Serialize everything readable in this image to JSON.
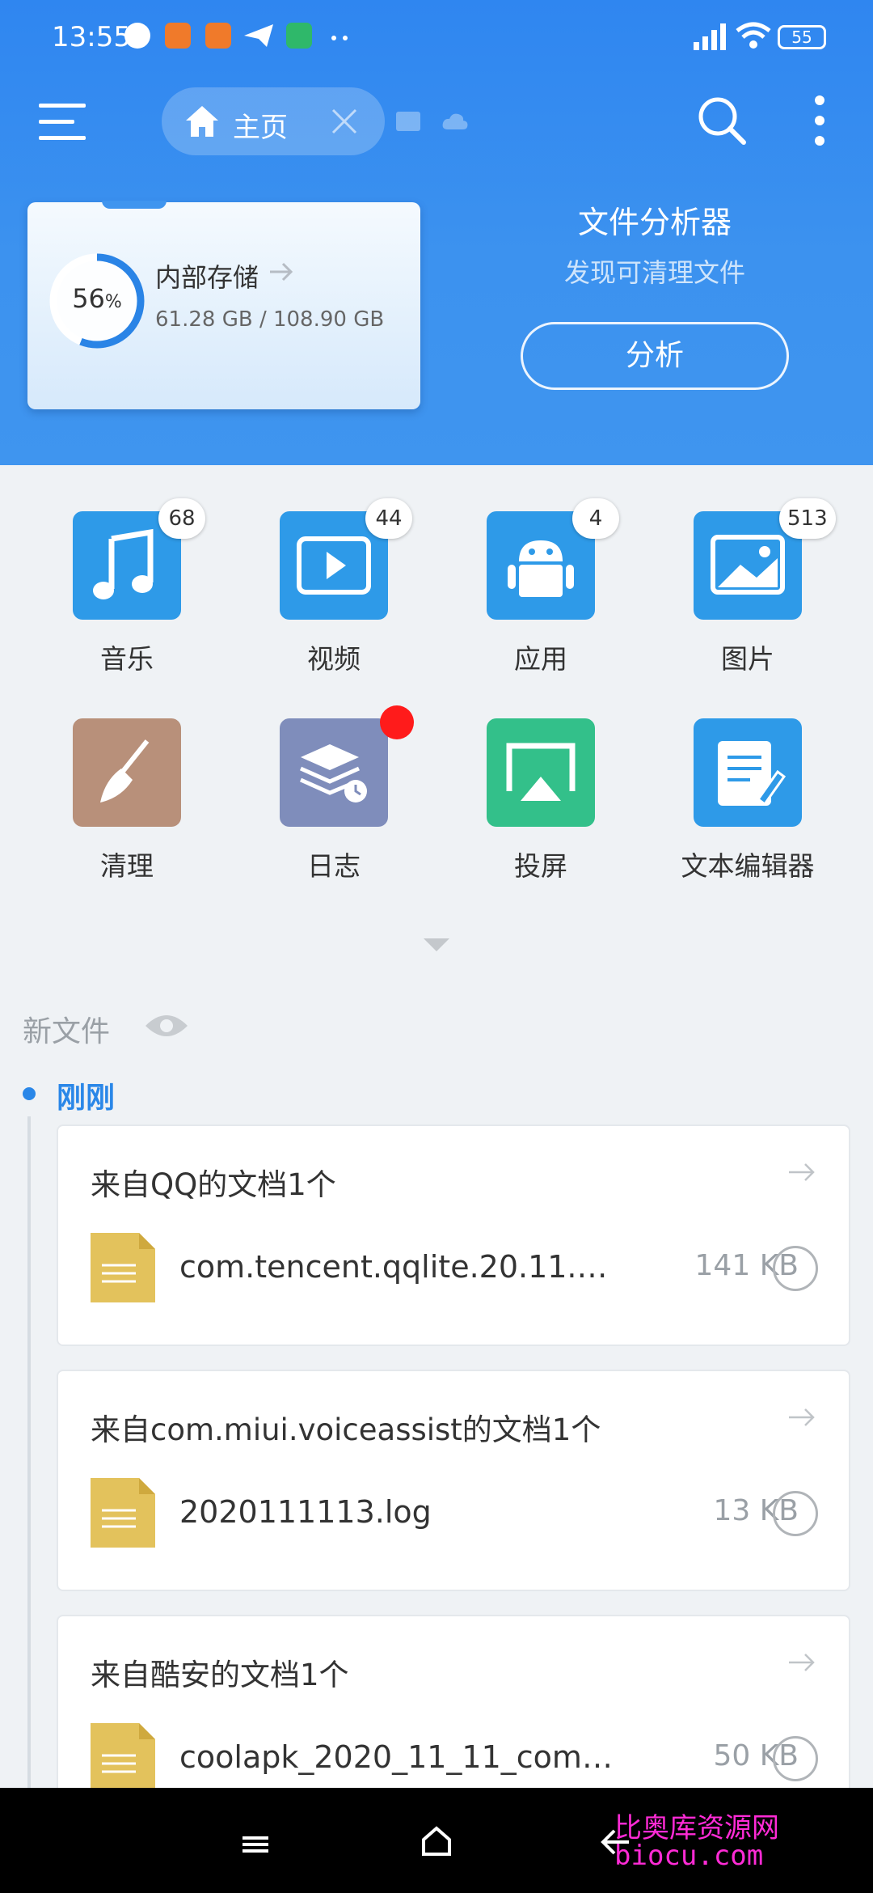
{
  "status_bar": {
    "time": "13:55",
    "battery": "55"
  },
  "app_bar": {
    "tab_label": "主页"
  },
  "storage": {
    "percent_value": "56",
    "percent_sign": "%",
    "name": "内部存储",
    "size": "61.28 GB / 108.90 GB",
    "used_fraction": 0.56
  },
  "analyzer": {
    "title": "文件分析器",
    "subtitle": "发现可清理文件",
    "button": "分析"
  },
  "grid": [
    {
      "label": "音乐",
      "badge": "68",
      "icon": "music-icon",
      "color": "#2e9ae8"
    },
    {
      "label": "视频",
      "badge": "44",
      "icon": "video-icon",
      "color": "#2e9ae8"
    },
    {
      "label": "应用",
      "badge": "4",
      "icon": "android-icon",
      "color": "#2e9ae8"
    },
    {
      "label": "图片",
      "badge": "513",
      "icon": "image-icon",
      "color": "#2e9ae8"
    },
    {
      "label": "清理",
      "badge": "",
      "icon": "broom-icon",
      "color": "#b8907a"
    },
    {
      "label": "日志",
      "badge": "",
      "icon": "log-stack-icon",
      "color": "#7f8dbb"
    },
    {
      "label": "投屏",
      "badge": "",
      "icon": "cast-screen-icon",
      "color": "#33c08a"
    },
    {
      "label": "文本编辑器",
      "badge": "",
      "icon": "text-edit-icon",
      "color": "#2e9ae8"
    }
  ],
  "new_files": {
    "heading": "新文件",
    "timeline_label": "刚刚",
    "groups": [
      {
        "title": "来自QQ的文档1个",
        "file_name": "com.tencent.qqlite.20.11.1…",
        "size": "141 KB"
      },
      {
        "title": "来自com.miui.voiceassist的文档1个",
        "file_name": "2020111113.log",
        "size": "13 KB"
      },
      {
        "title": "来自酷安的文档1个",
        "file_name": "coolapk_2020_11_11_com.…",
        "size": "50 KB"
      }
    ]
  },
  "watermark": {
    "line1": "比奥库资源网",
    "line2": "biocu.com"
  }
}
